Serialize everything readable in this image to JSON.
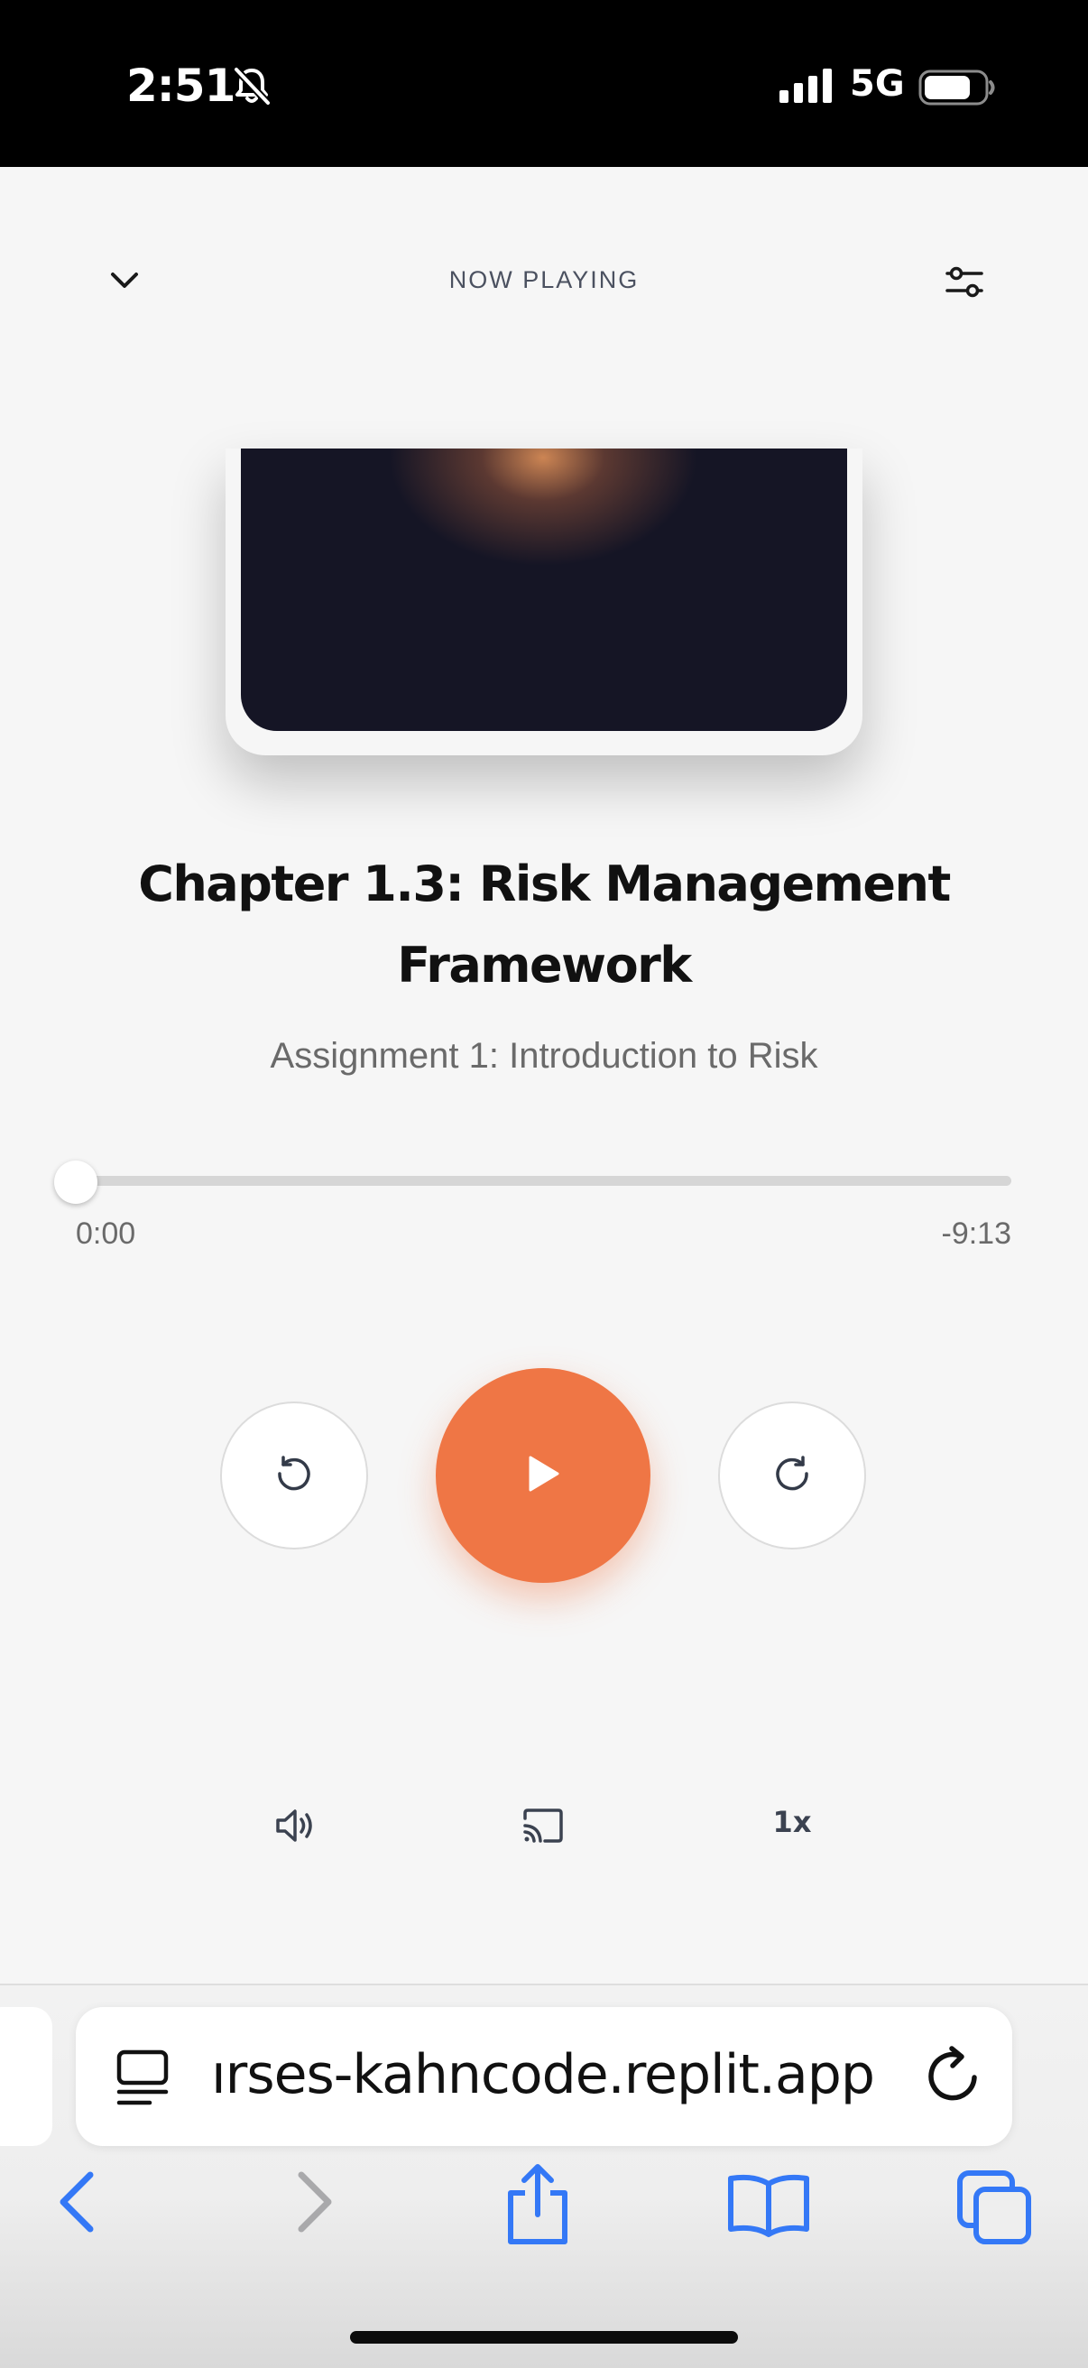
{
  "status_bar": {
    "time": "2:51",
    "network": "5G",
    "icons": [
      "bell-slash-icon",
      "signal-icon",
      "battery-icon"
    ]
  },
  "header": {
    "title": "NOW PLAYING",
    "icons": [
      "chevron-down-icon",
      "settings-sliders-icon"
    ]
  },
  "track": {
    "title": "Chapter 1.3: Risk Management Framework",
    "subtitle": "Assignment 1: Introduction to Risk",
    "elapsed": "0:00",
    "remaining": "-9:13",
    "progress": 0
  },
  "controls": {
    "speed": "1x",
    "icons": [
      "rewind-icon",
      "play-icon",
      "forward-icon",
      "volume-icon",
      "cast-icon"
    ]
  },
  "browser": {
    "url": "ırses-kahncode.replit.app",
    "icons": [
      "reader-icon",
      "reload-icon",
      "back-icon",
      "forward-nav-icon",
      "share-icon",
      "bookmarks-icon",
      "tabs-icon"
    ]
  },
  "colors": {
    "accent": "#ef7645",
    "background": "#f6f6f6",
    "browser_blue": "#3478f6",
    "status_bar": "#000000"
  }
}
